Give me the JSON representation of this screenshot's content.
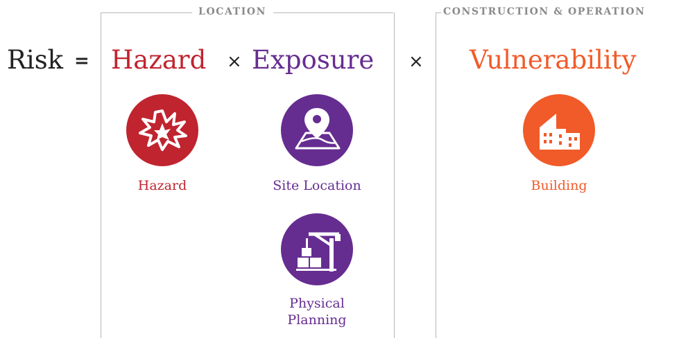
{
  "equation": {
    "risk": "Risk",
    "equals": "=",
    "hazard": "Hazard",
    "times": "×",
    "exposure": "Exposure",
    "vulnerability": "Vulnerability"
  },
  "groups": {
    "location": "LOCATION",
    "construction": "CONSTRUCTION & OPERATION"
  },
  "factors": [
    {
      "label": "Hazard",
      "icon": "explosion-icon",
      "color": "#c0242f"
    },
    {
      "label": "Site Location",
      "icon": "map-pin-icon",
      "color": "#662d91"
    },
    {
      "label": "Physical Planning",
      "icon": "crane-icon",
      "color": "#662d91"
    },
    {
      "label": "Building",
      "icon": "building-icon",
      "color": "#f15a29"
    }
  ],
  "colors": {
    "text": "#222222",
    "hazard": "#c0242f",
    "exposure": "#662d91",
    "vulnerability": "#f15a29",
    "border": "#b8b8b8",
    "label": "#8a8a8a"
  }
}
